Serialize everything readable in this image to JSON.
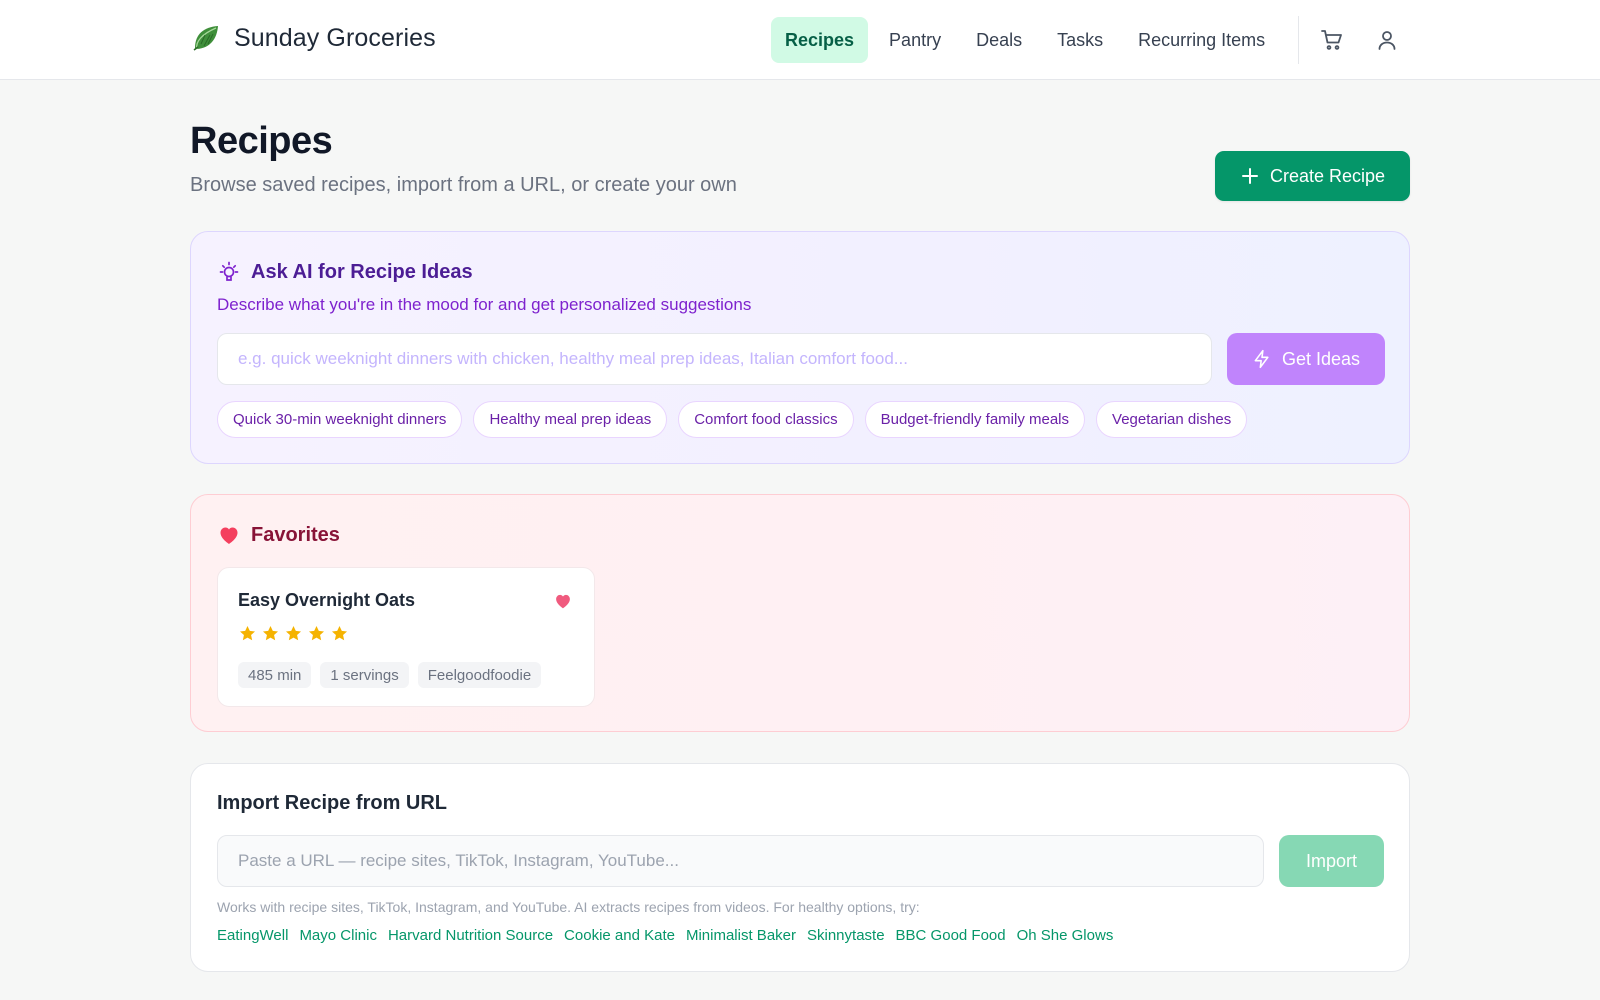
{
  "header": {
    "brand": "Sunday Groceries",
    "nav": [
      {
        "label": "Recipes",
        "active": true
      },
      {
        "label": "Pantry",
        "active": false
      },
      {
        "label": "Deals",
        "active": false
      },
      {
        "label": "Tasks",
        "active": false
      },
      {
        "label": "Recurring Items",
        "active": false
      }
    ],
    "icons": [
      "cart-icon",
      "user-icon"
    ]
  },
  "page": {
    "title": "Recipes",
    "subtitle": "Browse saved recipes, import from a URL, or create your own",
    "create_label": "Create Recipe"
  },
  "ai": {
    "title": "Ask AI for Recipe Ideas",
    "description": "Describe what you're in the mood for and get personalized suggestions",
    "placeholder": "e.g. quick weeknight dinners with chicken, healthy meal prep ideas, Italian comfort food...",
    "button_label": "Get Ideas",
    "chips": [
      "Quick 30-min weeknight dinners",
      "Healthy meal prep ideas",
      "Comfort food classics",
      "Budget-friendly family meals",
      "Vegetarian dishes"
    ]
  },
  "favorites": {
    "title": "Favorites",
    "recipes": [
      {
        "name": "Easy Overnight Oats",
        "rating": 5,
        "rating_max": 5,
        "tags": [
          "485 min",
          "1 servings",
          "Feelgoodfoodie"
        ]
      }
    ]
  },
  "import": {
    "title": "Import Recipe from URL",
    "placeholder": "Paste a URL — recipe sites, TikTok, Instagram, YouTube...",
    "button_label": "Import",
    "note": "Works with recipe sites, TikTok, Instagram, and YouTube. AI extracts recipes from videos. For healthy options, try:",
    "sources": [
      "EatingWell",
      "Mayo Clinic",
      "Harvard Nutrition Source",
      "Cookie and Kate",
      "Minimalist Baker",
      "Skinnytaste",
      "BBC Good Food",
      "Oh She Glows"
    ]
  },
  "colors": {
    "primary": "#059669",
    "ai_accent": "#7e22ce",
    "favorite": "#f43f5e",
    "star": "#f5b301"
  }
}
